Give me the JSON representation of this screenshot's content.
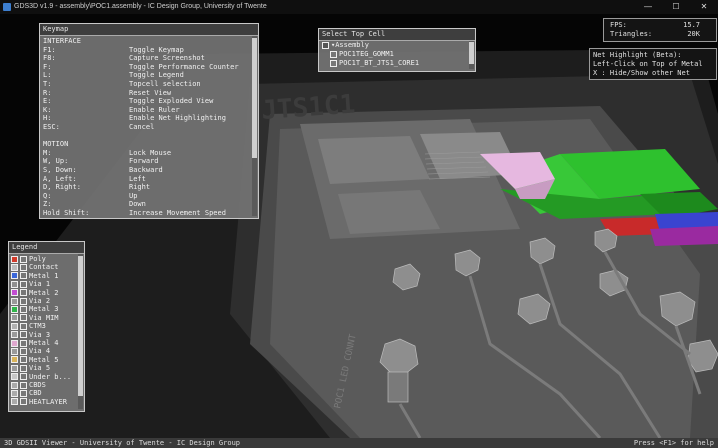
{
  "titlebar": {
    "title": "GDS3D v1.9  -  assembly\\POC1.assembly  -  IC Design Group, University of Twente",
    "min_glyph": "—",
    "max_glyph": "☐",
    "close_glyph": "✕"
  },
  "keymap": {
    "title": "Keymap",
    "sections": [
      {
        "heading": "INTERFACE",
        "rows": [
          {
            "key": "F1:",
            "action": "Toggle Keymap"
          },
          {
            "key": "F8:",
            "action": "Capture Screenshot"
          },
          {
            "key": "F:",
            "action": "Toggle Performance Counter"
          },
          {
            "key": "L:",
            "action": "Toggle Legend"
          },
          {
            "key": "T:",
            "action": "Topcell selection"
          },
          {
            "key": "R:",
            "action": "Reset View"
          },
          {
            "key": "E:",
            "action": "Toggle Exploded View"
          },
          {
            "key": "K:",
            "action": "Enable Ruler"
          },
          {
            "key": "H:",
            "action": "Enable Net Highlighting"
          },
          {
            "key": "ESC:",
            "action": "Cancel"
          }
        ]
      },
      {
        "heading": "MOTION",
        "rows": [
          {
            "key": "M:",
            "action": "Lock Mouse"
          },
          {
            "key": "W, Up:",
            "action": "Forward"
          },
          {
            "key": "S, Down:",
            "action": "Backward"
          },
          {
            "key": "A, Left:",
            "action": "Left"
          },
          {
            "key": "D, Right:",
            "action": "Right"
          },
          {
            "key": "Q:",
            "action": "Up"
          },
          {
            "key": "Z:",
            "action": "Down"
          },
          {
            "key": "Hold Shift:",
            "action": "Increase Movement Speed"
          }
        ]
      }
    ]
  },
  "topcell": {
    "title": "Select Top Cell",
    "root": {
      "label": "Assembly",
      "expander": "▾",
      "state": "partial"
    },
    "children": [
      {
        "label": "POC1TEG_GOMM1"
      },
      {
        "label": "POC1T_BT_JTS1_CORE1"
      }
    ]
  },
  "stats": {
    "fps_label": "FPS:",
    "fps_value": "15.7",
    "tri_label": "Triangles:",
    "tri_value": "20K"
  },
  "net_highlight": {
    "title": "Net Highlight (Beta):",
    "line1": "Left-Click on Top of Metal",
    "line2": "X : Hide/Show other Net"
  },
  "legend": {
    "title": "Legend",
    "rows": [
      {
        "label": "Poly",
        "color": "#d23a2a"
      },
      {
        "label": "Contact",
        "color": "#bdbdbd"
      },
      {
        "label": "Metal 1",
        "color": "#3b67d8"
      },
      {
        "label": "Via 1",
        "color": "#8f8f8f"
      },
      {
        "label": "Metal 2",
        "color": "#c24dd1"
      },
      {
        "label": "Via 2",
        "color": "#9a9a9a"
      },
      {
        "label": "Metal 3",
        "color": "#30b54a"
      },
      {
        "label": "Via MIM",
        "color": "#9a9a9a"
      },
      {
        "label": "CTM3",
        "color": "#b0b0b0"
      },
      {
        "label": "Via 3",
        "color": "#9a9a9a"
      },
      {
        "label": "Metal 4",
        "color": "#e0a8cf"
      },
      {
        "label": "Via 4",
        "color": "#9a9a9a"
      },
      {
        "label": "Metal 5",
        "color": "#d9b35a"
      },
      {
        "label": "Via 5",
        "color": "#9a9a9a"
      },
      {
        "label": "Under b...",
        "color": "#c8c8c8"
      },
      {
        "label": "CBDS",
        "color": "#aaaaaa"
      },
      {
        "label": "CBD",
        "color": "#aaaaaa"
      },
      {
        "label": "HEATLAYER",
        "color": "#aaaaaa"
      }
    ]
  },
  "scene": {
    "chip_label_top": "JTS1C1",
    "chip_label_bottom": "POC1 LED CONNT",
    "colors": {
      "metal_green": "#2ec12e",
      "metal_pink": "#e6b8e0",
      "metal_blue": "#3a44d0",
      "poly_red": "#c82a2a",
      "substrate": "#5a5a5a"
    }
  },
  "statusbar": {
    "left": "3D GDSII Viewer - University of Twente - IC Design Group",
    "right": "Press <F1> for help"
  }
}
